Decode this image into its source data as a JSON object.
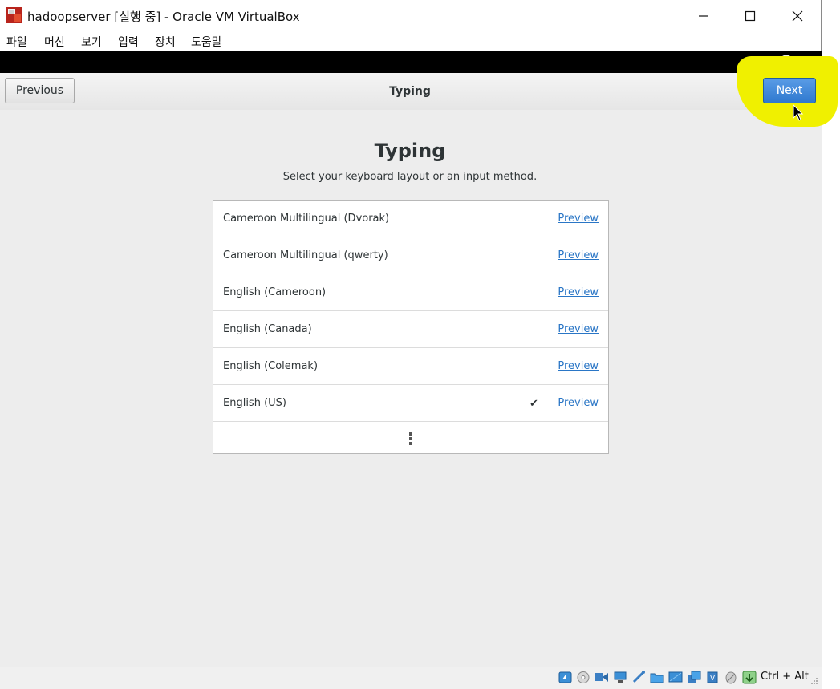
{
  "window": {
    "title": "hadoopserver [실행 중] - Oracle VM VirtualBox",
    "controls": [
      "minimize-icon",
      "maximize-icon",
      "close-icon"
    ]
  },
  "menubar": {
    "items": [
      "파일",
      "머신",
      "보기",
      "입력",
      "장치",
      "도움말"
    ]
  },
  "header": {
    "previous": "Previous",
    "title": "Typing",
    "next": "Next"
  },
  "main": {
    "title": "Typing",
    "subtitle": "Select your keyboard layout or an input method.",
    "layouts": [
      {
        "label": "Cameroon Multilingual (Dvorak)",
        "preview": "Preview",
        "selected": false
      },
      {
        "label": "Cameroon Multilingual (qwerty)",
        "preview": "Preview",
        "selected": false
      },
      {
        "label": "English (Cameroon)",
        "preview": "Preview",
        "selected": false
      },
      {
        "label": "English (Canada)",
        "preview": "Preview",
        "selected": false
      },
      {
        "label": "English (Colemak)",
        "preview": "Preview",
        "selected": false
      },
      {
        "label": "English (US)",
        "preview": "Preview",
        "selected": true
      }
    ],
    "check_mark": "✔"
  },
  "statusbar": {
    "host_key": "Ctrl + Alt",
    "icons": [
      "hard-disk-icon",
      "optical-drive-icon",
      "audio-icon",
      "network-icon",
      "usb-icon",
      "shared-folders-icon",
      "display-icon",
      "video-capture-icon",
      "drag-drop-icon",
      "cpu-icon",
      "mouse-integration-icon",
      "keyboard-capture-icon"
    ]
  },
  "colors": {
    "next_button": "#3a86d8",
    "highlight": "#f0f000",
    "link": "#2a76c6",
    "guest_top_bar": "#000000"
  }
}
